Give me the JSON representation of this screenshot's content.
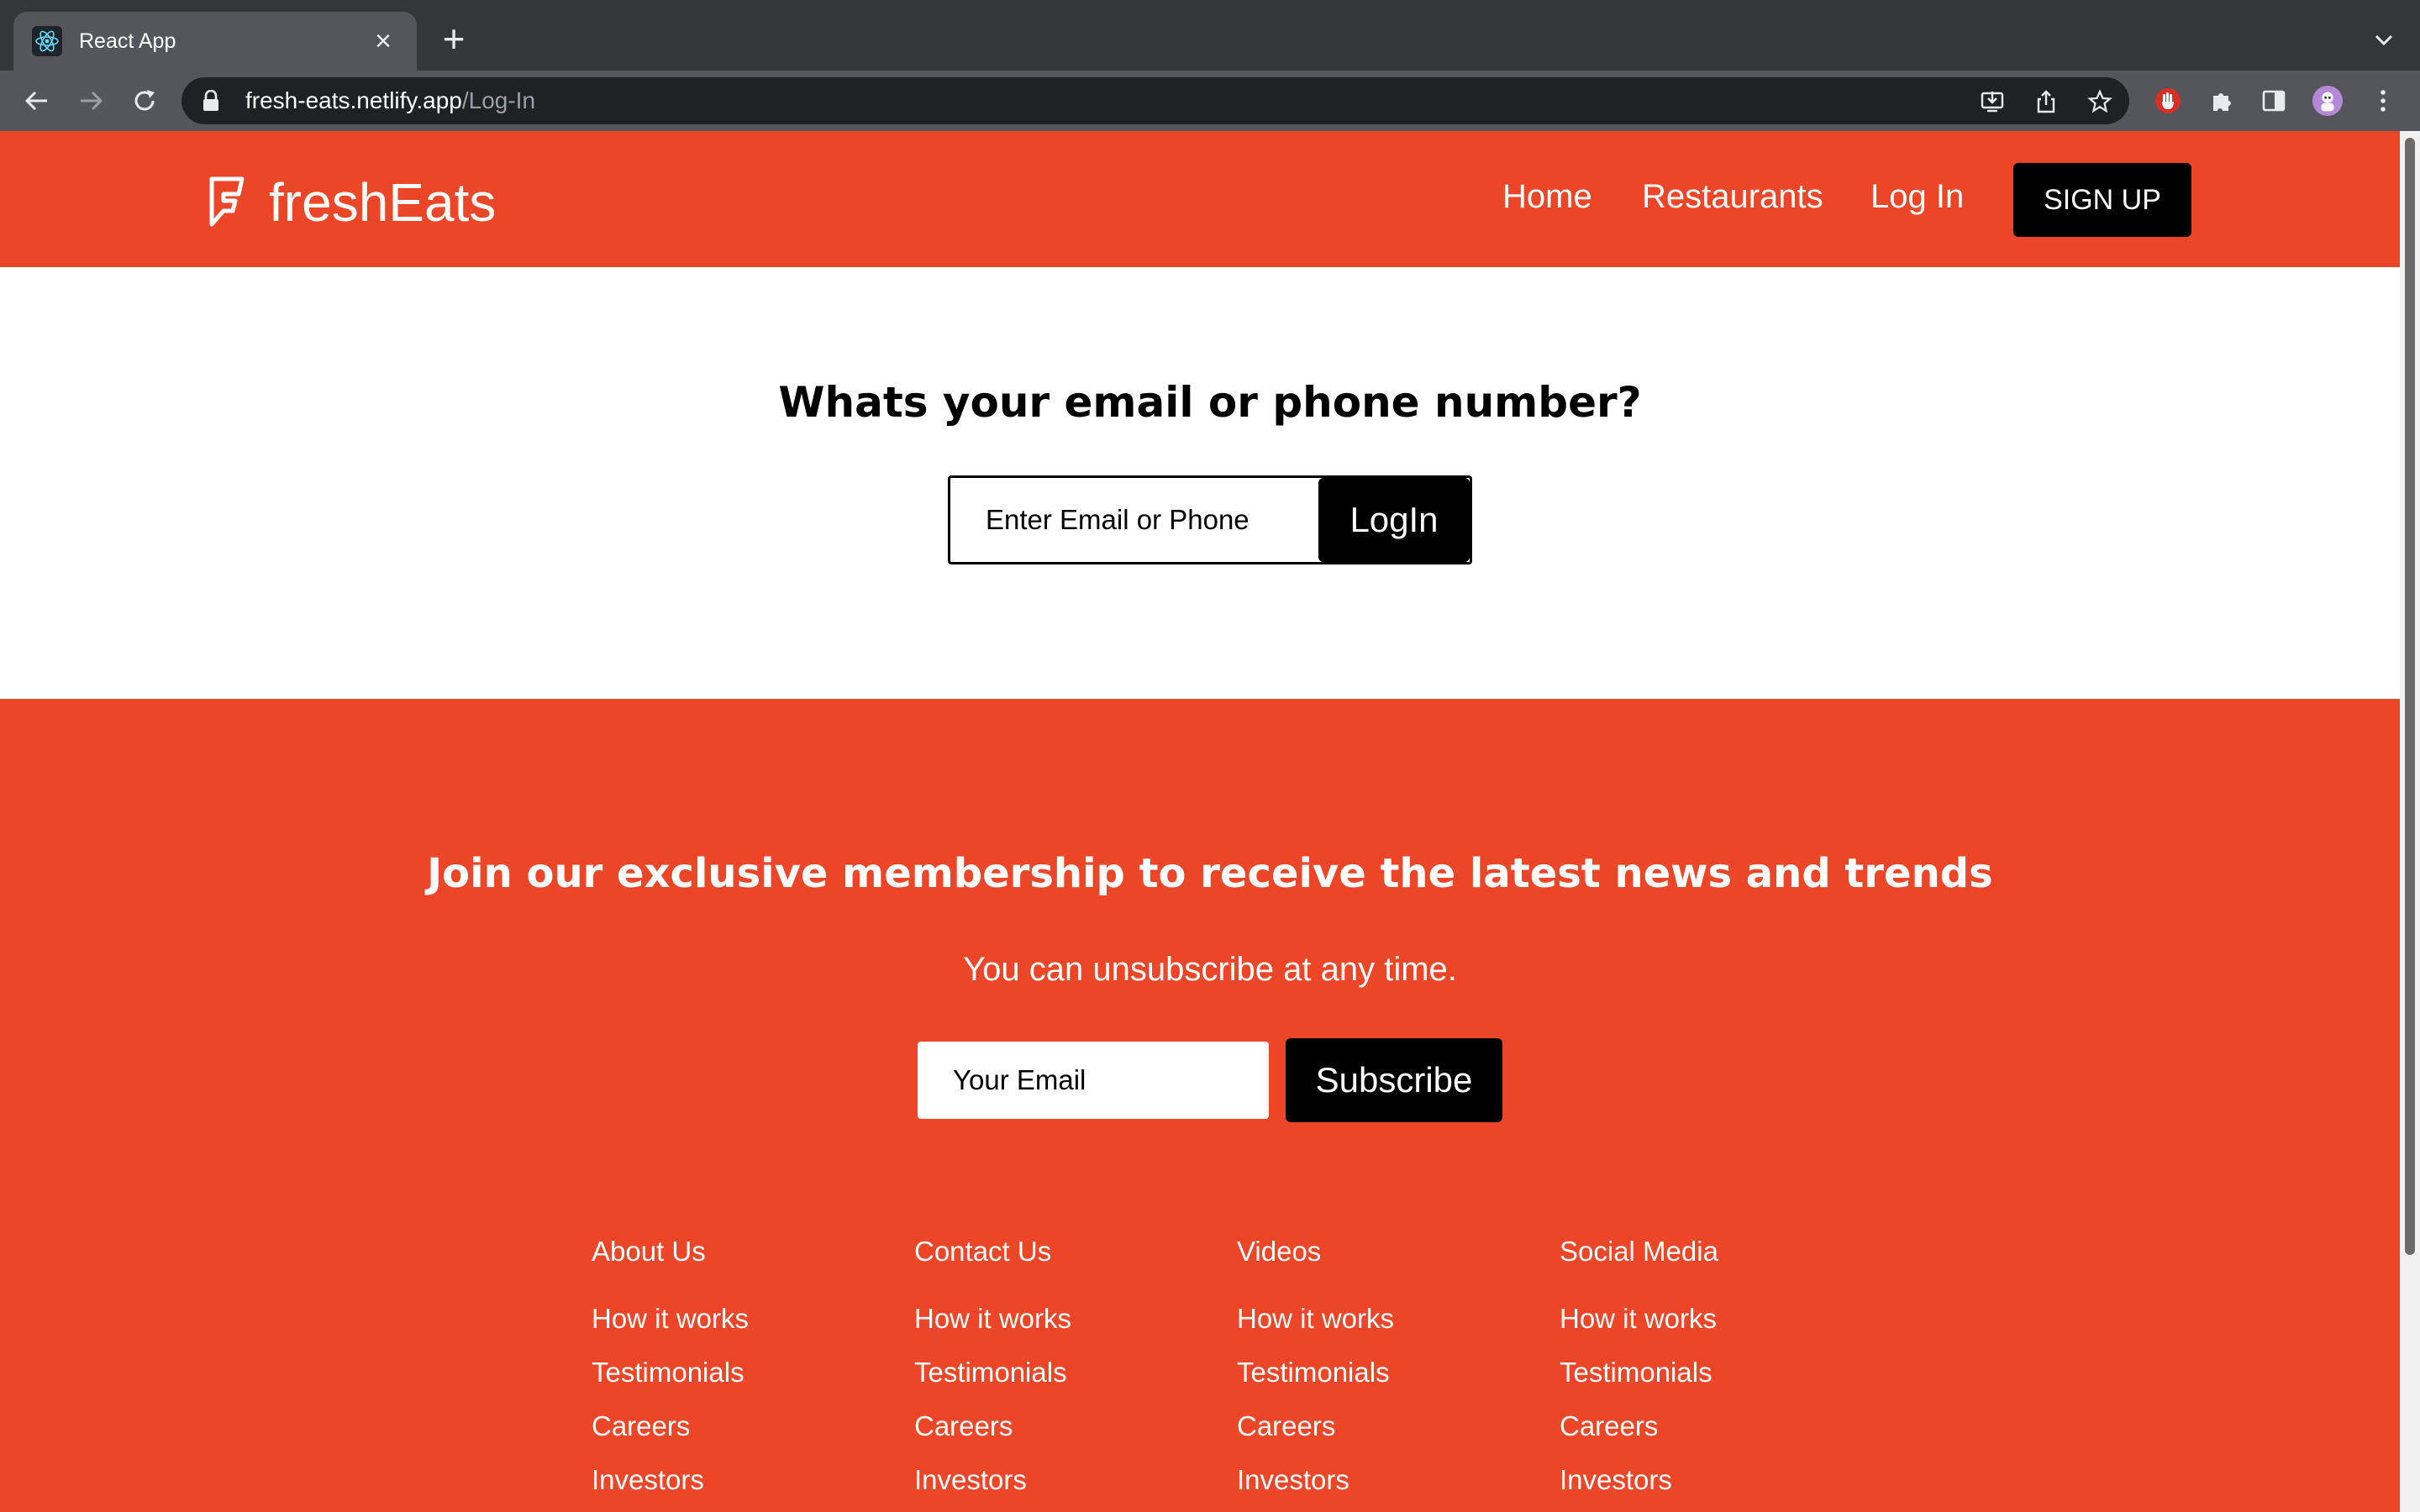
{
  "browser": {
    "tab_title": "React App",
    "url_host": "fresh-eats.netlify.app",
    "url_path": "/Log-In",
    "icons": [
      "react-favicon",
      "close-icon",
      "plus-icon",
      "chevron-down-icon",
      "back-arrow-icon",
      "forward-arrow-icon",
      "reload-icon",
      "lock-icon",
      "install-icon",
      "share-icon",
      "star-icon",
      "extension-red-hand-icon",
      "puzzle-icon",
      "side-panel-icon",
      "profile-avatar",
      "kebab-menu-icon"
    ]
  },
  "header": {
    "logo_text": "freshEats",
    "nav": {
      "home": "Home",
      "restaurants": "Restaurants",
      "login": "Log In"
    },
    "signup_label": "SIGN UP"
  },
  "login": {
    "heading": "Whats your email or phone number?",
    "input_placeholder": "Enter Email or Phone",
    "button_label": "LogIn"
  },
  "footer": {
    "heading": "Join our exclusive membership to receive the latest news and trends",
    "subheading": "You can unsubscribe at any time.",
    "email_placeholder": "Your Email",
    "subscribe_label": "Subscribe",
    "columns": [
      {
        "title": "About Us",
        "links": [
          "How it works",
          "Testimonials",
          "Careers",
          "Investors"
        ]
      },
      {
        "title": "Contact Us",
        "links": [
          "How it works",
          "Testimonials",
          "Careers",
          "Investors"
        ]
      },
      {
        "title": "Videos",
        "links": [
          "How it works",
          "Testimonials",
          "Careers",
          "Investors"
        ]
      },
      {
        "title": "Social Media",
        "links": [
          "How it works",
          "Testimonials",
          "Careers",
          "Investors"
        ]
      }
    ]
  },
  "colors": {
    "brand_orange": "#ec4628",
    "button_black": "#000000",
    "chrome_dark": "#35363a",
    "chrome_toolbar": "#54565b"
  }
}
